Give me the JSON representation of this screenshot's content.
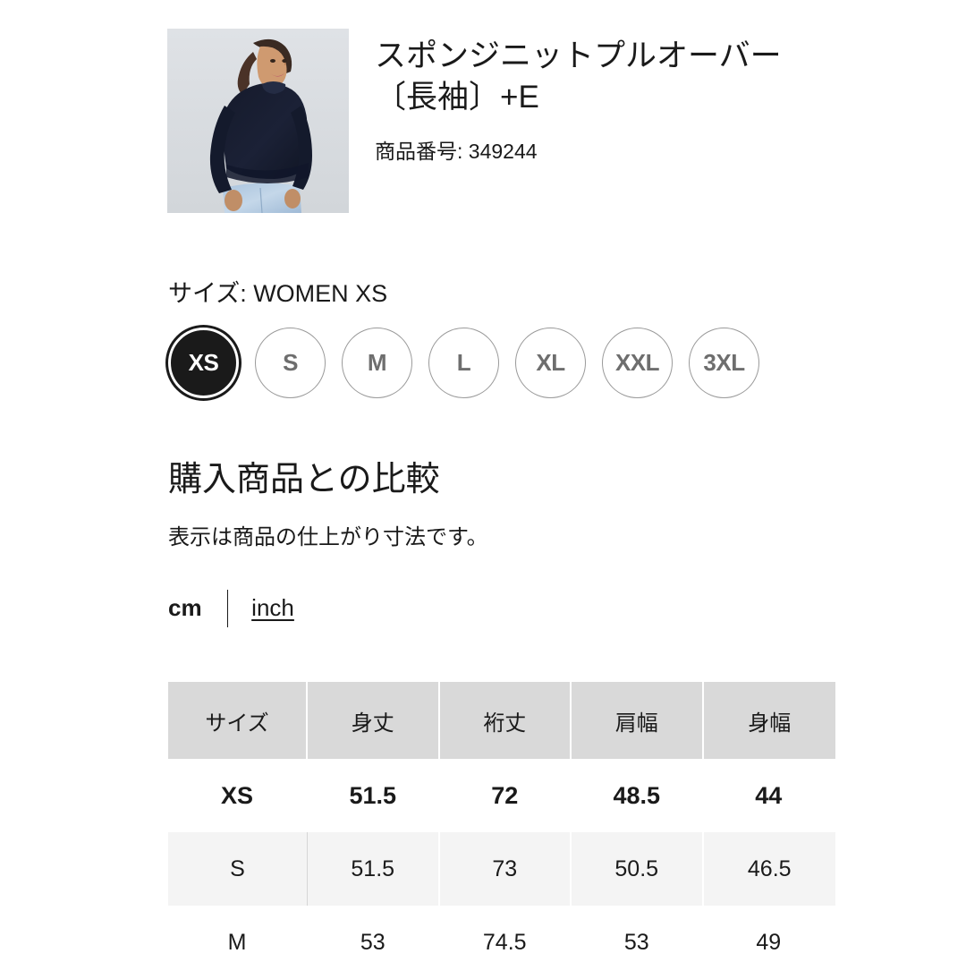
{
  "product": {
    "title": "スポンジニットプルオーバー〔長袖〕+E",
    "code_label": "商品番号: 349244",
    "image_alt": "model-wearing-navy-sponge-knit-pullover"
  },
  "size_selector": {
    "label": "サイズ: WOMEN XS",
    "selected": "XS",
    "options": [
      {
        "label": "XS",
        "selected": true
      },
      {
        "label": "S",
        "selected": false
      },
      {
        "label": "M",
        "selected": false
      },
      {
        "label": "L",
        "selected": false
      },
      {
        "label": "XL",
        "selected": false
      },
      {
        "label": "XXL",
        "selected": false
      },
      {
        "label": "3XL",
        "selected": false
      }
    ]
  },
  "comparison": {
    "heading": "購入商品との比較",
    "note": "表示は商品の仕上がり寸法です。",
    "unit_active": "cm",
    "unit_link": "inch"
  },
  "table": {
    "headers": [
      "サイズ",
      "身丈",
      "裄丈",
      "肩幅",
      "身幅"
    ],
    "rows": [
      {
        "cells": [
          "XS",
          "51.5",
          "72",
          "48.5",
          "44"
        ],
        "highlight": true,
        "shade": "white"
      },
      {
        "cells": [
          "S",
          "51.5",
          "73",
          "50.5",
          "46.5"
        ],
        "highlight": false,
        "shade": "gray"
      },
      {
        "cells": [
          "M",
          "53",
          "74.5",
          "53",
          "49"
        ],
        "highlight": false,
        "shade": "white"
      }
    ]
  },
  "colors": {
    "text": "#1a1a1a",
    "header_bg": "#d9d9d9",
    "row_alt_bg": "#f4f4f4",
    "chip_border": "#9a9a9a",
    "chip_text": "#6e6e6e",
    "selected_bg": "#1a1a1a"
  }
}
